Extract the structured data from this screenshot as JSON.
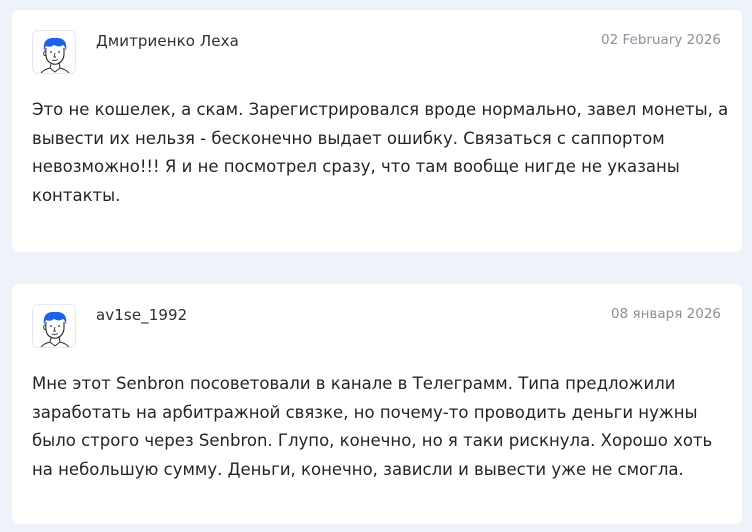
{
  "reviews": [
    {
      "author": "Дмитриенко Леха",
      "date": "02 February 2026",
      "avatar_icon": "user-sketch-icon",
      "text": "Это не кошелек, а скам. Зарегистрировался вроде нормально, завел монеты, а вывести их нельзя - бесконечно выдает ошибку. Связаться с саппортом невозможно!!! Я и не посмотрел сразу, что там вообще нигде не указаны контакты."
    },
    {
      "author": "av1se_1992",
      "date": "08 января 2026",
      "avatar_icon": "user-sketch-icon",
      "text": "Мне этот Senbron посоветовали в канале в Телеграмм. Типа предложили заработать на арбитражной связке, но почему-то проводить деньги нужны было строго через Senbron. Глупо, конечно, но я таки рискнула. Хорошо хоть на небольшую сумму. Деньги, конечно, зависли и вывести уже не смогла."
    }
  ],
  "colors": {
    "page_background": "#eef2f9",
    "card_background": "#ffffff",
    "avatar_hair": "#1e63e6",
    "date_text": "#8b909a"
  }
}
